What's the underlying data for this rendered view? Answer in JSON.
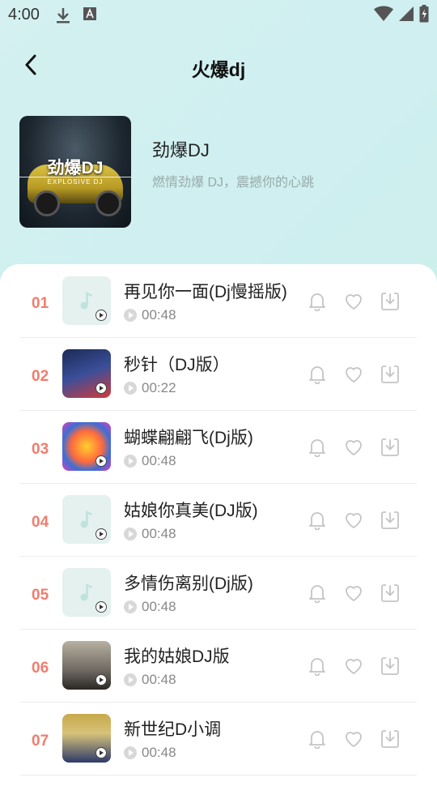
{
  "status_bar": {
    "time": "4:00"
  },
  "header": {
    "title": "火爆dj"
  },
  "album": {
    "cover_title": "劲爆DJ",
    "cover_subtitle": "EXPLOSIVE DJ"
  },
  "playlist": {
    "name": "劲爆DJ",
    "description": "燃情劲爆 DJ，震撼你的心跳"
  },
  "songs": [
    {
      "num": "01",
      "title": "再见你一面(Dj慢摇版)",
      "duration": "00:48",
      "thumb": "default"
    },
    {
      "num": "02",
      "title": "秒针（DJ版）",
      "duration": "00:22",
      "thumb": "art-2"
    },
    {
      "num": "03",
      "title": "蝴蝶翩翩飞(Dj版)",
      "duration": "00:48",
      "thumb": "art-3"
    },
    {
      "num": "04",
      "title": "姑娘你真美(DJ版)",
      "duration": "00:48",
      "thumb": "default"
    },
    {
      "num": "05",
      "title": "多情伤离别(Dj版)",
      "duration": "00:48",
      "thumb": "default"
    },
    {
      "num": "06",
      "title": "我的姑娘DJ版",
      "duration": "00:48",
      "thumb": "art-6"
    },
    {
      "num": "07",
      "title": "新世纪D小调",
      "duration": "00:48",
      "thumb": "art-7"
    }
  ],
  "colors": {
    "accent_number": "#f07d6e",
    "icon_gray": "#c4c4c4"
  }
}
